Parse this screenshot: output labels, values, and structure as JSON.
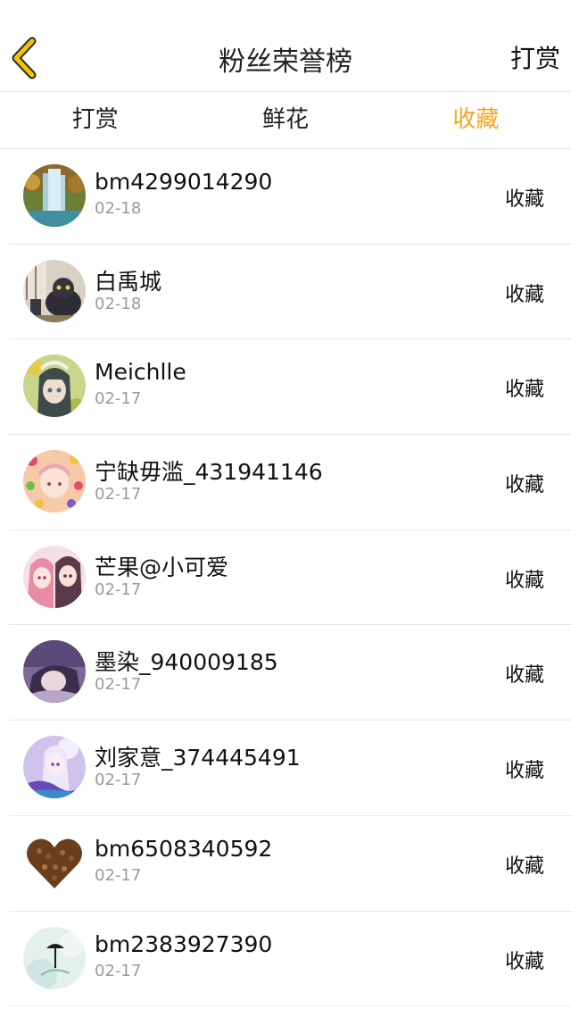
{
  "header": {
    "title": "粉丝荣誉榜",
    "right_action": "打赏"
  },
  "tabs": [
    {
      "label": "打赏",
      "active": false
    },
    {
      "label": "鲜花",
      "active": false
    },
    {
      "label": "收藏",
      "active": true
    }
  ],
  "accent_color": "#f5a623",
  "fans": [
    {
      "name": "bm4299014290",
      "date": "02-18",
      "action": "收藏"
    },
    {
      "name": "白禹城",
      "date": "02-18",
      "action": "收藏"
    },
    {
      "name": "Meichlle",
      "date": "02-17",
      "action": "收藏"
    },
    {
      "name": "宁缺毋滥_431941146",
      "date": "02-17",
      "action": "收藏"
    },
    {
      "name": "芒果@小可爱",
      "date": "02-17",
      "action": "收藏"
    },
    {
      "name": "墨染_940009185",
      "date": "02-17",
      "action": "收藏"
    },
    {
      "name": "刘家意_374445491",
      "date": "02-17",
      "action": "收藏"
    },
    {
      "name": "bm6508340592",
      "date": "02-17",
      "action": "收藏"
    },
    {
      "name": "bm2383927390",
      "date": "02-17",
      "action": "收藏"
    }
  ]
}
